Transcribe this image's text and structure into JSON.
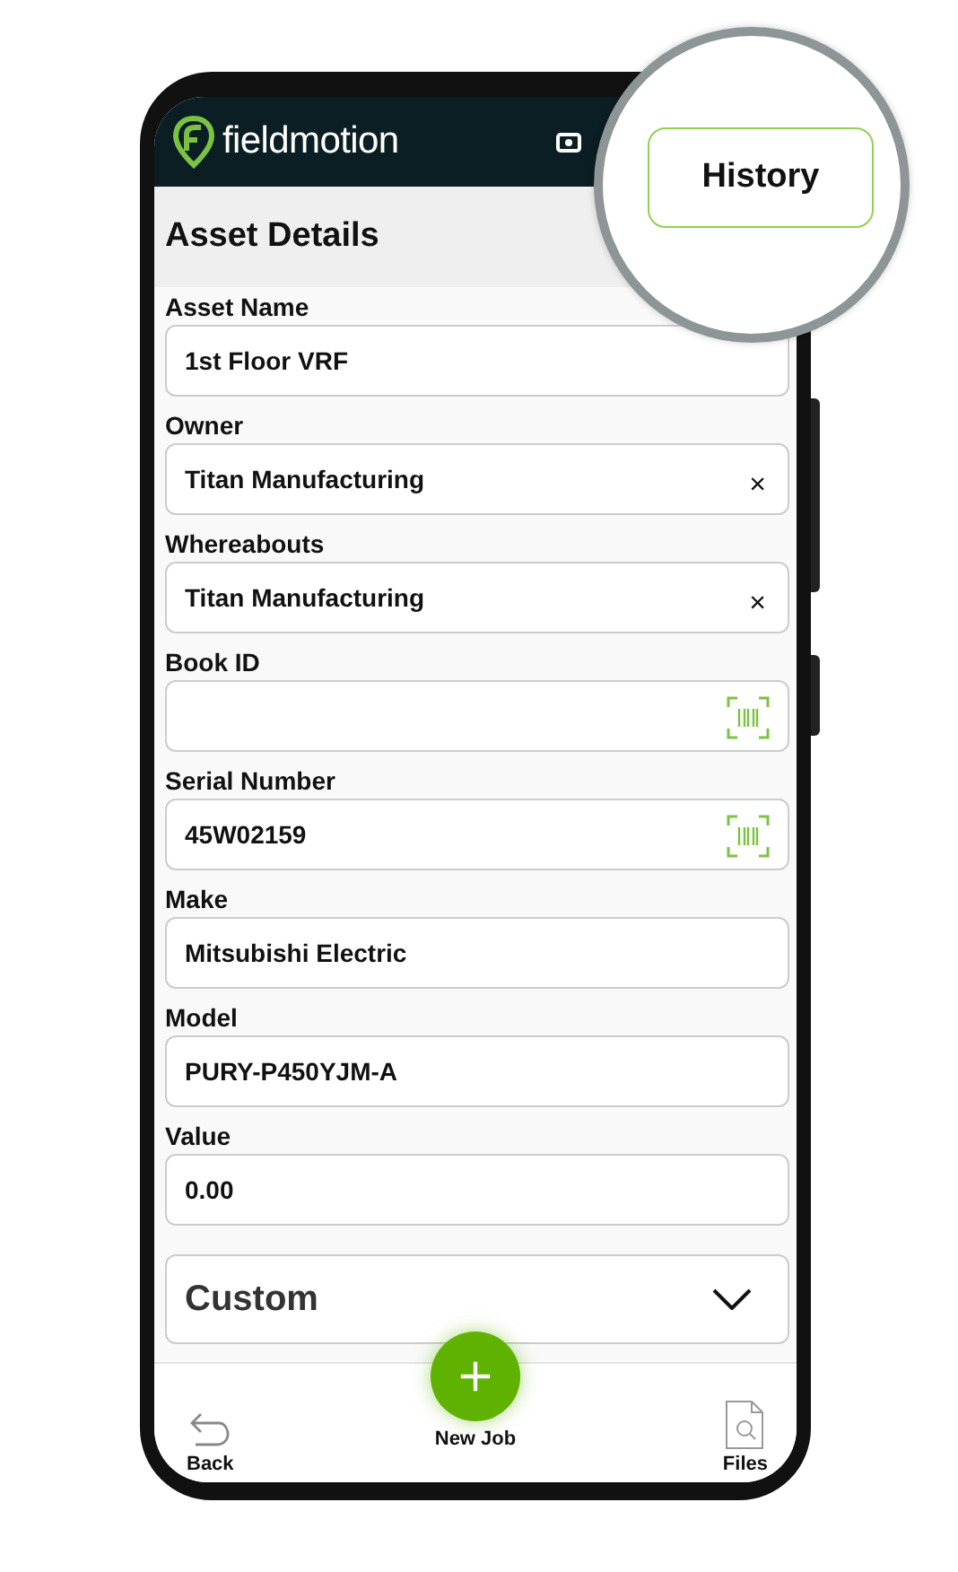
{
  "header": {
    "logo_text": "fieldmotion"
  },
  "callout": {
    "button": "History"
  },
  "section": {
    "title": "Asset Details"
  },
  "fields": [
    {
      "kind": "text",
      "label": "Asset Name",
      "value": "1st Floor VRF"
    },
    {
      "kind": "clearable",
      "label": "Owner",
      "value": "Titan Manufacturing",
      "clear_text": "×"
    },
    {
      "kind": "clearable",
      "label": "Whereabouts",
      "value": "Titan Manufacturing",
      "clear_text": "×"
    },
    {
      "kind": "scannable",
      "label": "Book ID"
    },
    {
      "kind": "scannable",
      "label": "Serial Number",
      "value": "45W02159"
    },
    {
      "kind": "text",
      "label": "Make",
      "value": "Mitsubishi Electric"
    },
    {
      "kind": "text",
      "label": "Model",
      "value": "PURY-P450YJM-A"
    },
    {
      "kind": "text",
      "label": "Value",
      "value": "0.00"
    }
  ],
  "custom": {
    "title": "Custom",
    "expanded": false
  },
  "bottom_nav": [
    {
      "kind": "back",
      "label": "Back"
    },
    {
      "kind": "fab",
      "label": "New Job"
    },
    {
      "kind": "files",
      "label": "Files"
    }
  ]
}
